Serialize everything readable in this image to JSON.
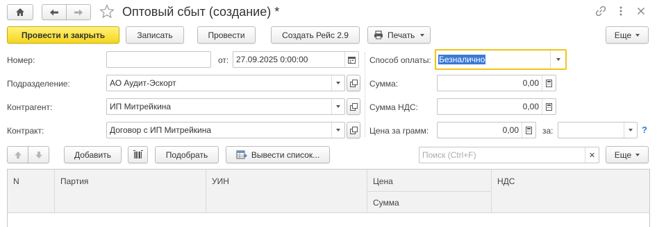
{
  "window": {
    "title": "Оптовый сбыт (создание) *"
  },
  "toolbar": {
    "post_close": "Провести и закрыть",
    "save": "Записать",
    "post": "Провести",
    "create_trip": "Создать Рейс 2.9",
    "print": "Печать",
    "more": "Еще"
  },
  "form": {
    "number_label": "Номер:",
    "number_value": "",
    "date_label": "от:",
    "date_value": "27.09.2025  0:00:00",
    "division_label": "Подразделение:",
    "division_value": "АО Аудит-Эскорт",
    "counterparty_label": "Контрагент:",
    "counterparty_value": "ИП Митрейкина",
    "contract_label": "Контракт:",
    "contract_value": "Договор с ИП Митрейкина",
    "payment_label": "Способ оплаты:",
    "payment_value": "Безналично",
    "sum_label": "Сумма:",
    "sum_value": "0,00",
    "vat_label": "Сумма НДС:",
    "vat_value": "0,00",
    "price_gram_label": "Цена за грамм:",
    "price_gram_value": "0,00",
    "per_label": "за:",
    "per_value": "",
    "help": "?"
  },
  "table_toolbar": {
    "add": "Добавить",
    "select": "Подобрать",
    "export_list": "Вывести список...",
    "search_placeholder": "Поиск (Ctrl+F)",
    "more": "Еще"
  },
  "table": {
    "columns": {
      "n": "N",
      "batch": "Партия",
      "uin": "УИН",
      "price": "Цена",
      "amount": "Сумма",
      "vat": "НДС"
    }
  },
  "colors": {
    "accent_yellow": "#f5d61c",
    "focus_border": "#f0c419",
    "selection": "#3a78d8",
    "help_blue": "#2a7fd4"
  }
}
